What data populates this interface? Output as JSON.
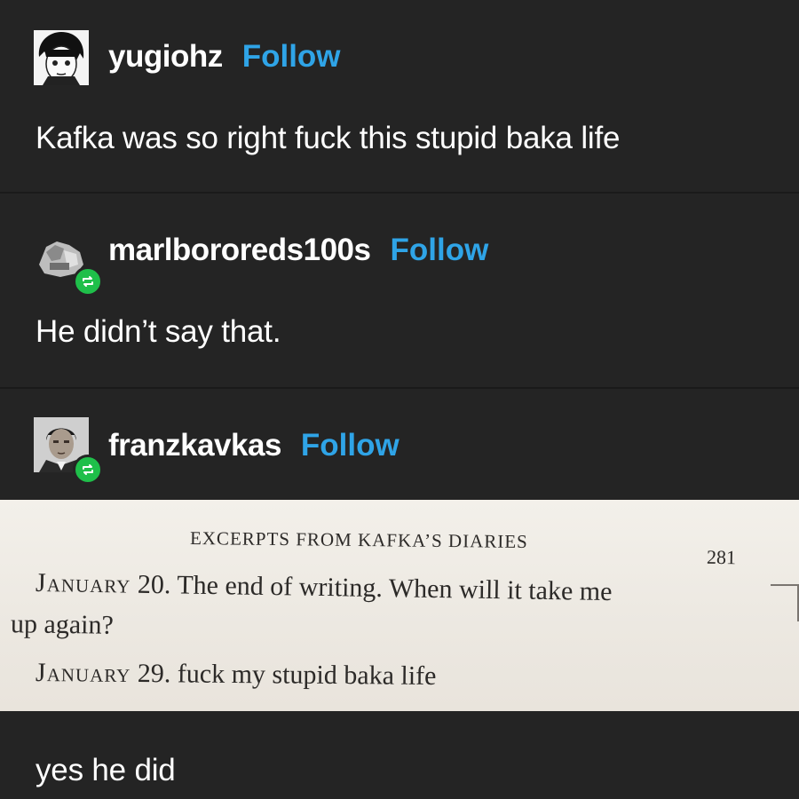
{
  "posts": [
    {
      "username": "yugiohz",
      "follow_label": "Follow",
      "text": "Kafka was so right fuck this stupid baka life",
      "avatar_icon": "manga-avatar-icon",
      "reblog": false
    },
    {
      "username": "marlbororeds100s",
      "follow_label": "Follow",
      "text": "He didn’t say that.",
      "avatar_icon": "photo-avatar-icon",
      "reblog": true
    },
    {
      "username": "franzkavkas",
      "follow_label": "Follow",
      "avatar_icon": "portrait-avatar-icon",
      "reblog": true,
      "image": {
        "heading": "EXCERPTS FROM KAFKA’S DIARIES",
        "page_number": "281",
        "entry1_month": "January",
        "entry1_text": "20. The end of writing. When will it take me",
        "entry1_cont": "up again?",
        "entry2_month": "January",
        "entry2_date": "29.",
        "entry2_text": "fuck my stupid baka life"
      },
      "text": "yes he did"
    }
  ],
  "colors": {
    "background": "#242424",
    "follow": "#2fa4e7",
    "reblog_badge": "#1fbf4a"
  }
}
